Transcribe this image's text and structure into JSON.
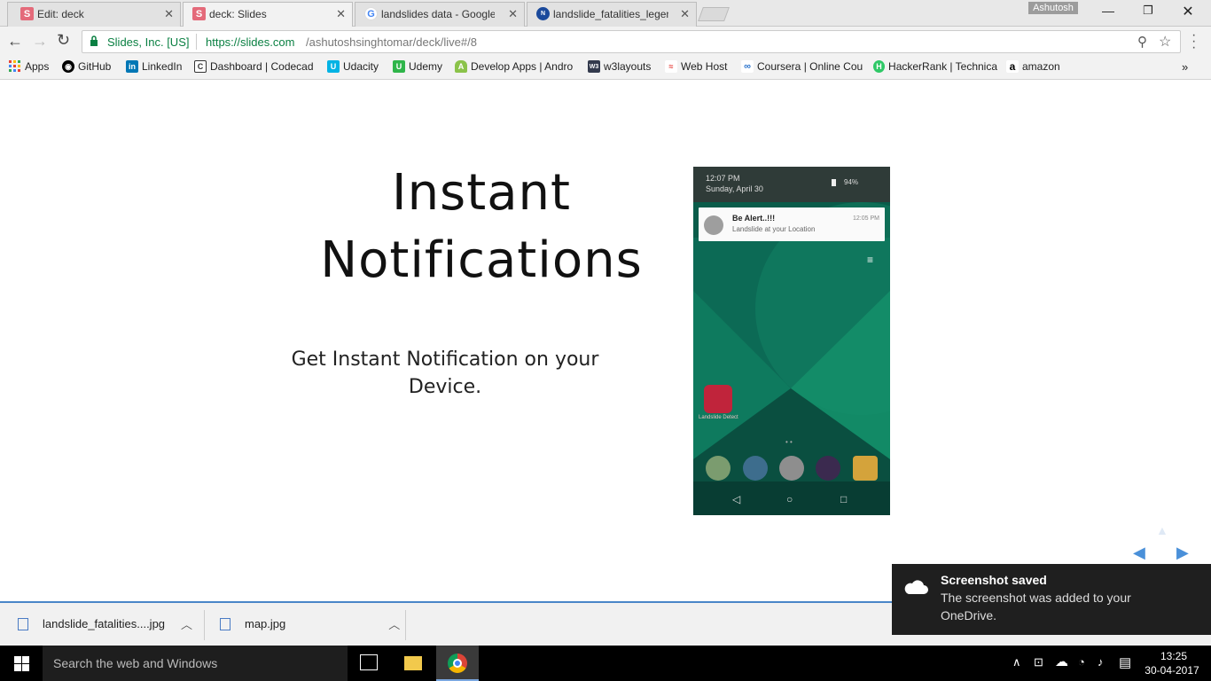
{
  "tabs": [
    {
      "title": "Edit: deck",
      "favicon": "S"
    },
    {
      "title": "deck: Slides",
      "favicon": "S"
    },
    {
      "title": "landslides data - Google",
      "favicon": "G"
    },
    {
      "title": "landslide_fatalities_legen",
      "favicon": "N"
    }
  ],
  "window": {
    "user": "Ashutosh"
  },
  "omnibox": {
    "security_label": "Slides, Inc. [US]",
    "url_host": "https://slides.com",
    "url_path": "/ashutoshsinghtomar/deck/live#/8"
  },
  "bookmarks": [
    {
      "label": "Apps",
      "icon": "apps-grid-icon",
      "color": "#4285f4"
    },
    {
      "label": "GitHub",
      "icon": "github-icon",
      "color": "#000000"
    },
    {
      "label": "LinkedIn",
      "icon": "linkedin-icon",
      "color": "#0077b5"
    },
    {
      "label": "Dashboard | Codecad",
      "icon": "codecademy-icon",
      "color": "#333333"
    },
    {
      "label": "Udacity",
      "icon": "udacity-icon",
      "color": "#02b3e4"
    },
    {
      "label": "Udemy",
      "icon": "udemy-icon",
      "color": "#2fb54a"
    },
    {
      "label": "Develop Apps | Andro",
      "icon": "android-icon",
      "color": "#8bc34a"
    },
    {
      "label": "w3layouts",
      "icon": "w3layouts-icon",
      "color": "#333a4d"
    },
    {
      "label": "Web Host",
      "icon": "webhost-icon",
      "color": "#e53935"
    },
    {
      "label": "Coursera | Online Cou",
      "icon": "coursera-icon",
      "color": "#2a73cc"
    },
    {
      "label": "HackerRank | Technica",
      "icon": "hackerrank-icon",
      "color": "#2ec866"
    },
    {
      "label": "amazon",
      "icon": "amazon-icon",
      "color": "#000000"
    }
  ],
  "slide": {
    "title_line1": "Instant",
    "title_line2": "Notifications",
    "subtitle_line1": "Get Instant Notification on your",
    "subtitle_line2": "Device."
  },
  "phone": {
    "time": "12:07 PM",
    "date": "Sunday, April 30",
    "battery": "94%",
    "notification_title": "Be Alert..!!!",
    "notification_body": "Landslide at your Location",
    "notification_time": "12:05 PM",
    "app_label": "Landslide Detect"
  },
  "downloads": [
    {
      "name": "landslide_fatalities....jpg"
    },
    {
      "name": "map.jpg"
    }
  ],
  "toast": {
    "title": "Screenshot saved",
    "line1": "The screenshot was added to your",
    "line2": "OneDrive."
  },
  "taskbar": {
    "search_placeholder": "Search the web and Windows",
    "time": "13:25",
    "date": "30-04-2017"
  },
  "colors": {
    "accent": "#4a86c8",
    "secure": "#0b8043",
    "nav_arrow": "#4a90d9"
  }
}
